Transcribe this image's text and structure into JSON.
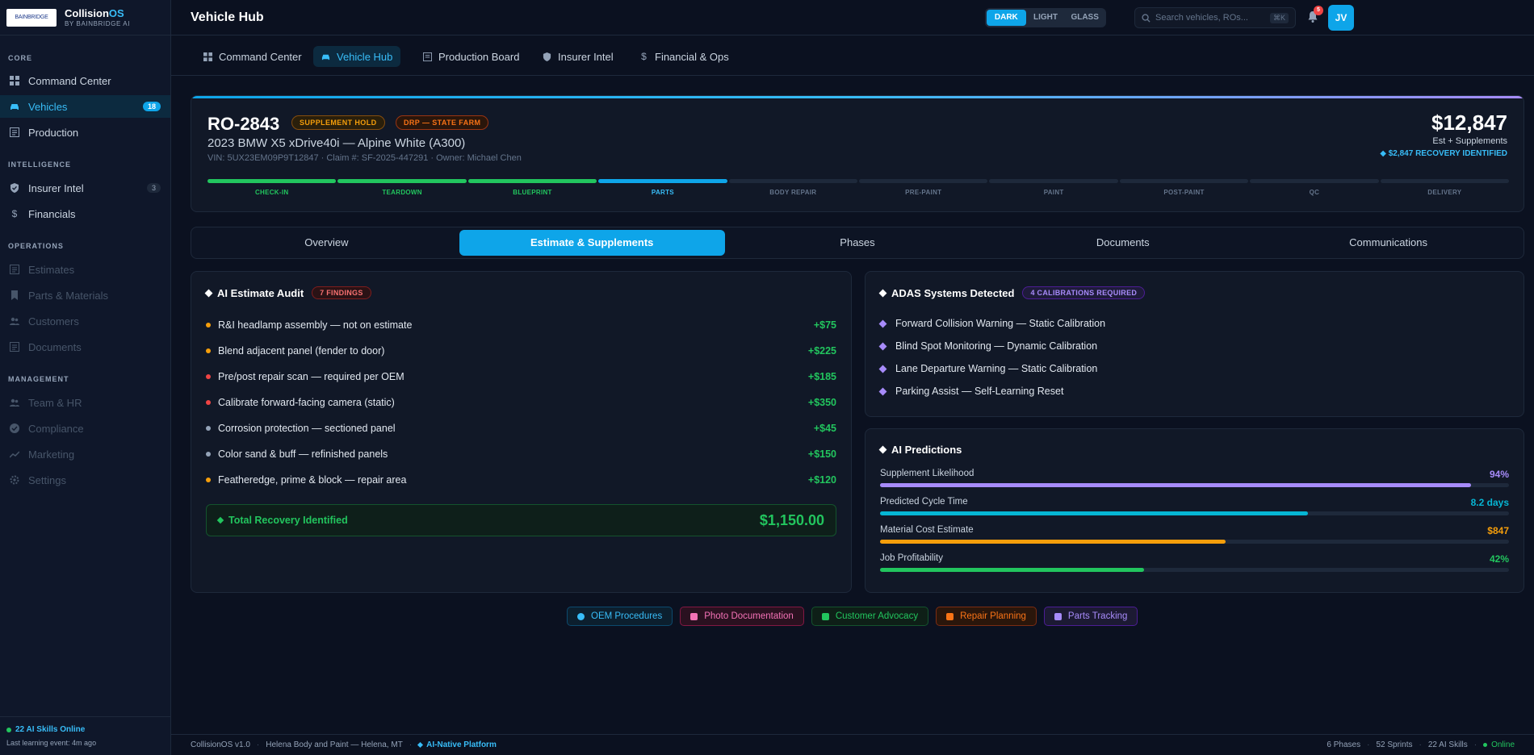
{
  "brand": {
    "logo_text": "BAINBRIDGE",
    "name_a": "Collision",
    "name_b": "OS",
    "sub": "BY BAINBRIDGE AI"
  },
  "sidebar": {
    "sections": [
      "CORE",
      "INTELLIGENCE",
      "OPERATIONS",
      "MANAGEMENT"
    ],
    "items": [
      {
        "label": "Command Center"
      },
      {
        "label": "Vehicles",
        "count": "18"
      },
      {
        "label": "Production"
      },
      {
        "label": "Insurer Intel",
        "count": "3"
      },
      {
        "label": "Financials"
      },
      {
        "label": "Estimates"
      },
      {
        "label": "Parts & Materials"
      },
      {
        "label": "Customers"
      },
      {
        "label": "Documents"
      },
      {
        "label": "Team & HR"
      },
      {
        "label": "Compliance"
      },
      {
        "label": "Marketing"
      },
      {
        "label": "Settings"
      }
    ],
    "footer": {
      "online": "22 AI Skills Online",
      "learning": "Last learning event: 4m ago"
    }
  },
  "header": {
    "title": "Vehicle Hub",
    "themes": [
      "DARK",
      "LIGHT",
      "GLASS"
    ],
    "search_placeholder": "Search vehicles, ROs...",
    "search_kbd": "⌘K",
    "notifications": "5",
    "avatar": "JV"
  },
  "tabs": [
    {
      "label": "Command Center"
    },
    {
      "label": "Vehicle Hub"
    },
    {
      "label": "Production Board"
    },
    {
      "label": "Insurer Intel"
    },
    {
      "label": "Financial & Ops"
    }
  ],
  "ro": {
    "id": "RO-2843",
    "status": "SUPPLEMENT HOLD",
    "program": "DRP — STATE FARM",
    "vehicle": "2023 BMW X5 xDrive40i — Alpine White (A300)",
    "meta": "VIN: 5UX23EM09P9T12847 · Claim #: SF-2025-447291 · Owner: Michael Chen",
    "amount": "$12,847",
    "amount_sub": "Est + Supplements",
    "recovery": "$2,847 RECOVERY IDENTIFIED",
    "phases": [
      "CHECK-IN",
      "TEARDOWN",
      "BLUEPRINT",
      "PARTS",
      "BODY REPAIR",
      "PRE-PAINT",
      "PAINT",
      "POST-PAINT",
      "QC",
      "DELIVERY"
    ]
  },
  "subtabs": [
    "Overview",
    "Estimate & Supplements",
    "Phases",
    "Documents",
    "Communications"
  ],
  "audit": {
    "title": "AI Estimate Audit",
    "badge": "7 FINDINGS",
    "items": [
      {
        "text": "R&I headlamp assembly — not on estimate",
        "amount": "+$75",
        "color": "#f59e0b"
      },
      {
        "text": "Blend adjacent panel (fender to door)",
        "amount": "+$225",
        "color": "#f59e0b"
      },
      {
        "text": "Pre/post repair scan — required per OEM",
        "amount": "+$185",
        "color": "#ef4444"
      },
      {
        "text": "Calibrate forward-facing camera (static)",
        "amount": "+$350",
        "color": "#ef4444"
      },
      {
        "text": "Corrosion protection — sectioned panel",
        "amount": "+$45",
        "color": "#94a3b8"
      },
      {
        "text": "Color sand & buff — refinished panels",
        "amount": "+$150",
        "color": "#94a3b8"
      },
      {
        "text": "Featheredge, prime & block — repair area",
        "amount": "+$120",
        "color": "#f59e0b"
      }
    ],
    "total_label": "Total Recovery Identified",
    "total_value": "$1,150.00"
  },
  "adas": {
    "title": "ADAS Systems Detected",
    "badge": "4 CALIBRATIONS REQUIRED",
    "items": [
      "Forward Collision Warning — Static Calibration",
      "Blind Spot Monitoring — Dynamic Calibration",
      "Lane Departure Warning — Static Calibration",
      "Parking Assist — Self-Learning Reset"
    ]
  },
  "predictions": {
    "title": "AI Predictions",
    "items": [
      {
        "label": "Supplement Likelihood",
        "value": "94%",
        "fill": 0.94,
        "color": "#a78bfa"
      },
      {
        "label": "Predicted Cycle Time",
        "value": "8.2 days",
        "fill": 0.68,
        "color": "#06b6d4"
      },
      {
        "label": "Material Cost Estimate",
        "value": "$847",
        "fill": 0.55,
        "color": "#f59e0b"
      },
      {
        "label": "Job Profitability",
        "value": "42%",
        "fill": 0.42,
        "color": "#22c55e"
      }
    ]
  },
  "chips": [
    {
      "label": "OEM Procedures",
      "color": "#38bdf8",
      "bg": "#0c1f2e",
      "border": "#0c4a6e"
    },
    {
      "label": "Photo Documentation",
      "color": "#f472b6",
      "bg": "#2a1120",
      "border": "#831843"
    },
    {
      "label": "Customer Advocacy",
      "color": "#22c55e",
      "bg": "#0e1f17",
      "border": "#14532d"
    },
    {
      "label": "Repair Planning",
      "color": "#f97316",
      "bg": "#2a160b",
      "border": "#7c2d12"
    },
    {
      "label": "Parts Tracking",
      "color": "#a78bfa",
      "bg": "#1c1a33",
      "border": "#4c1d95"
    }
  ],
  "footer": {
    "version": "CollisionOS v1.0",
    "shop": "Helena Body and Paint — Helena, MT",
    "platform": "AI-Native Platform",
    "phases": "6 Phases",
    "sprints": "52 Sprints",
    "skills": "22 AI Skills",
    "status": "Online"
  }
}
